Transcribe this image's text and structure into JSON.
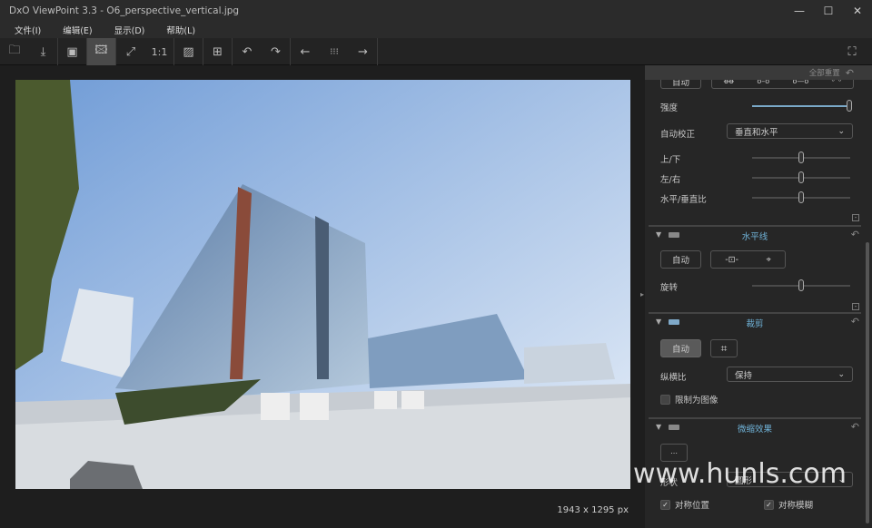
{
  "window": {
    "title": "DxO ViewPoint 3.3 - O6_perspective_vertical.jpg",
    "minimize": "—",
    "maximize": "☐",
    "close": "✕"
  },
  "menu": [
    "文件(I)",
    "编辑(E)",
    "显示(D)",
    "帮助(L)"
  ],
  "toolbar": {
    "one_to_one": "1:1"
  },
  "viewer": {
    "dimensions": "1943 x 1295 px"
  },
  "panel": {
    "reset_all": "全部重置",
    "perspective": {
      "auto": "自动",
      "intensity_label": "强度",
      "intensity": 1.0,
      "auto_correct_label": "自动校正",
      "auto_correct_value": "垂直和水平",
      "up_down_label": "上/下",
      "up_down": 0.5,
      "left_right_label": "左/右",
      "left_right": 0.5,
      "ratio_label": "水平/垂直比",
      "ratio": 0.5
    },
    "horizon": {
      "title": "水平线",
      "auto": "自动",
      "rotate_label": "旋转",
      "rotate": 0.5
    },
    "crop": {
      "title": "裁剪",
      "auto": "自动",
      "aspect_label": "纵横比",
      "aspect_value": "保持",
      "limit_label": "限制为图像",
      "limit_checked": false
    },
    "miniature": {
      "title": "微缩效果",
      "shape_label": "形状",
      "shape_value": "圆形",
      "sym_pos_label": "对称位置",
      "sym_blur_label": "对称模糊",
      "sym_pos_checked": true,
      "sym_blur_checked": true
    }
  },
  "watermark": "www.hunls.com"
}
